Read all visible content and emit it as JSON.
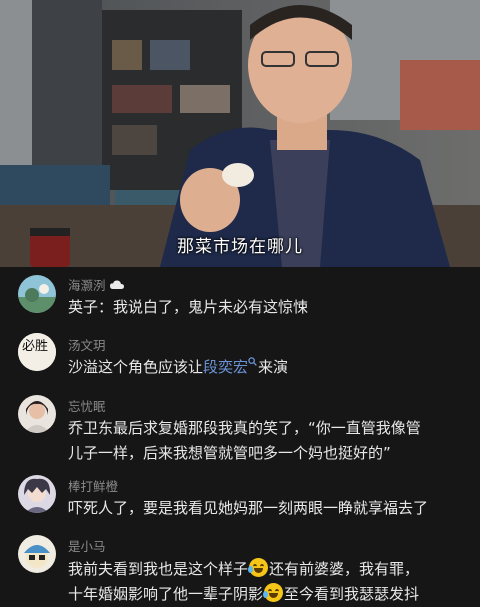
{
  "video": {
    "subtitle": "那菜市场在哪儿"
  },
  "comments": [
    {
      "username": "海灏洌",
      "username_badge_icon": "cloud-icon",
      "avatar_icon": "landscape-avatar-icon",
      "text": "英子：我说白了，鬼片未必有这惊悚"
    },
    {
      "username": "汤文玥",
      "avatar_icon": "calligraphy-avatar-icon",
      "avatar_text": "必胜",
      "text_before": "沙溢这个角色应该让",
      "link_text": "段奕宏",
      "link_icon": "search-icon",
      "text_after": "来演"
    },
    {
      "username": "忘忧眠",
      "avatar_icon": "portrait-avatar-icon",
      "line1": "乔卫东最后求复婚那段我真的笑了，“你一直管我像管",
      "line2": "儿子一样，后来我想管就管吧多一个妈也挺好的”"
    },
    {
      "username": "棒打鲜橙",
      "avatar_icon": "anime-avatar-icon",
      "text": "吓死人了，要是我看见她妈那一刻两眼一睁就享福去了"
    },
    {
      "username": "是小马",
      "avatar_icon": "cartoon-avatar-icon",
      "line1_a": "我前夫看到我也是这个样子",
      "line1_b": "还有前婆婆，我有罪，",
      "line2_a": "十年婚姻影响了他一辈子阴影",
      "line2_b": "至今看到我瑟瑟发抖",
      "emoji_icon": "laughing-crying-emoji-icon"
    }
  ]
}
